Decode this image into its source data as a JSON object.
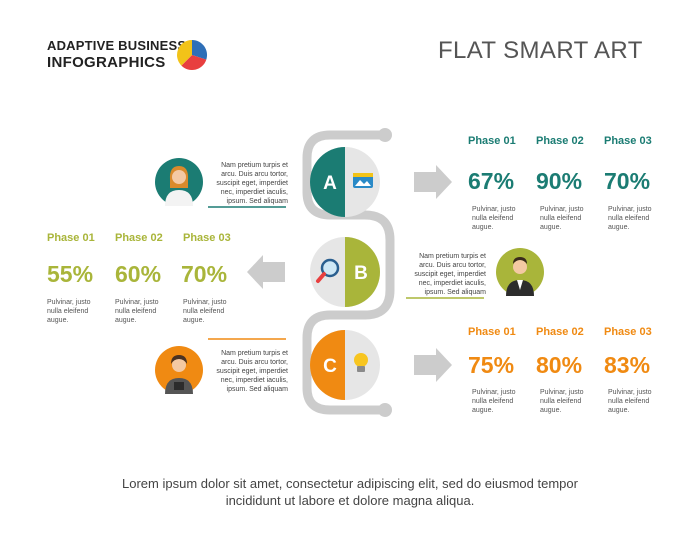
{
  "brand": {
    "line1": "ADAPTIVE BUSINESS",
    "line2": "INFOGRAPHICS"
  },
  "title": "FLAT SMART ART",
  "colors": {
    "a": "#1b7c73",
    "b": "#a9b53a",
    "c": "#f08a12",
    "gray": "#cccccc",
    "text": "#444444"
  },
  "items": [
    {
      "letter": "A",
      "icon": "image-icon",
      "description": "Nam pretium turpis et arcu. Duis arcu tortor, suscipit eget, imperdiet nec, imperdiet iaculis, ipsum. Sed aliquam",
      "phases": [
        {
          "label": "Phase 01",
          "value": "67%",
          "note": "Pulvinar, justo nulla eleifend augue."
        },
        {
          "label": "Phase 02",
          "value": "90%",
          "note": "Pulvinar, justo nulla eleifend augue."
        },
        {
          "label": "Phase 03",
          "value": "70%",
          "note": "Pulvinar, justo nulla eleifend augue."
        }
      ]
    },
    {
      "letter": "B",
      "icon": "magnifier-icon",
      "description": "Nam pretium turpis et arcu. Duis arcu tortor, suscipit eget, imperdiet nec, imperdiet iaculis, ipsum. Sed aliquam",
      "phases": [
        {
          "label": "Phase 01",
          "value": "55%",
          "note": "Pulvinar, justo nulla eleifend augue."
        },
        {
          "label": "Phase 02",
          "value": "60%",
          "note": "Pulvinar, justo nulla eleifend augue."
        },
        {
          "label": "Phase 03",
          "value": "70%",
          "note": "Pulvinar, justo nulla eleifend augue."
        }
      ]
    },
    {
      "letter": "C",
      "icon": "lightbulb-icon",
      "description": "Nam pretium turpis et arcu. Duis arcu tortor, suscipit eget, imperdiet nec, imperdiet iaculis, ipsum. Sed aliquam",
      "phases": [
        {
          "label": "Phase 01",
          "value": "75%",
          "note": "Pulvinar, justo nulla eleifend augue."
        },
        {
          "label": "Phase 02",
          "value": "80%",
          "note": "Pulvinar, justo nulla eleifend augue."
        },
        {
          "label": "Phase 03",
          "value": "83%",
          "note": "Pulvinar, justo nulla eleifend augue."
        }
      ]
    }
  ],
  "footer": {
    "line1": "Lorem ipsum dolor sit amet, consectetur adipiscing elit, sed do eiusmod tempor",
    "line2": "incididunt ut labore et dolore magna aliqua."
  }
}
